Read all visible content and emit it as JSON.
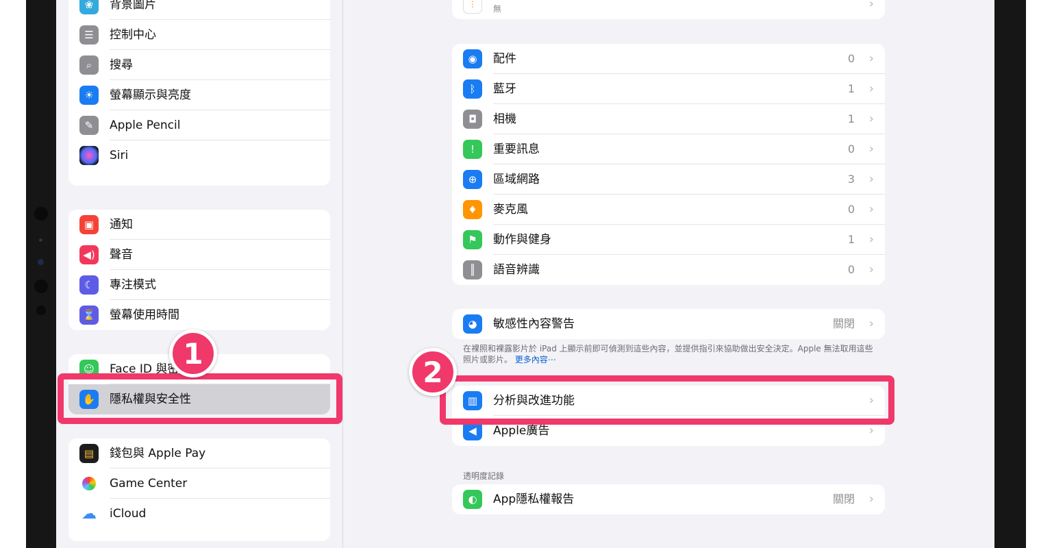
{
  "sidebar": {
    "group1": [
      {
        "icon": "wallpaper-icon",
        "label": "背景圖片",
        "color": "#34aadc"
      },
      {
        "icon": "control-center-icon",
        "label": "控制中心",
        "color": "#8e8e93"
      },
      {
        "icon": "search-icon",
        "label": "搜尋",
        "color": "#8e8e93"
      },
      {
        "icon": "brightness-icon",
        "label": "螢幕顯示與亮度",
        "color": "#1a7cf2"
      },
      {
        "icon": "pencil-icon",
        "label": "Apple Pencil",
        "color": "#8e8e93"
      },
      {
        "icon": "siri-icon",
        "label": "Siri",
        "color": "#333333"
      }
    ],
    "group2": [
      {
        "icon": "notification-icon",
        "label": "通知",
        "color": "#f44336"
      },
      {
        "icon": "sound-icon",
        "label": "聲音",
        "color": "#f2385a"
      },
      {
        "icon": "moon-icon",
        "label": "專注模式",
        "color": "#5e5ce6"
      },
      {
        "icon": "hourglass-icon",
        "label": "螢幕使用時間",
        "color": "#5e5ce6"
      }
    ],
    "group3": [
      {
        "icon": "faceid-icon",
        "label": "Face ID 與密碼",
        "color": "#34c759"
      },
      {
        "icon": "hand-icon",
        "label": "隱私權與安全性",
        "color": "#1a7cf2"
      }
    ],
    "group4": [
      {
        "icon": "wallet-icon",
        "label": "錢包與 Apple Pay",
        "color": "#1c1c1e"
      },
      {
        "icon": "game-center-icon",
        "label": "Game Center",
        "color": "#ffffff"
      },
      {
        "icon": "icloud-icon",
        "label": "iCloud",
        "color": "#ffffff"
      }
    ]
  },
  "detail": {
    "top_value": "無",
    "group1": [
      {
        "icon": "accessory-icon",
        "label": "配件",
        "value": "0",
        "color": "#1a7cf2"
      },
      {
        "icon": "bluetooth-icon",
        "label": "藍牙",
        "value": "1",
        "color": "#1a7cf2"
      },
      {
        "icon": "camera-icon",
        "label": "相機",
        "value": "1",
        "color": "#8e8e93"
      },
      {
        "icon": "critical-message-icon",
        "label": "重要訊息",
        "value": "0",
        "color": "#34c759"
      },
      {
        "icon": "globe-icon",
        "label": "區域網路",
        "value": "3",
        "color": "#1a7cf2"
      },
      {
        "icon": "microphone-icon",
        "label": "麥克風",
        "value": "0",
        "color": "#ff9500"
      },
      {
        "icon": "fitness-icon",
        "label": "動作與健身",
        "value": "1",
        "color": "#34c759"
      },
      {
        "icon": "speech-icon",
        "label": "語音辨識",
        "value": "0",
        "color": "#8e8e93"
      }
    ],
    "sensitive": {
      "icon": "eye-warning-icon",
      "label": "敏感性內容警告",
      "value": "關閉",
      "color": "#1a7cf2"
    },
    "footnote_text": "在裸照和裸露影片於 iPad 上顯示前即可偵測到這些內容，並提供指引來協助做出安全決定。Apple 無法取用這些照片或影片。",
    "footnote_more": "更多內容⋯",
    "group3": [
      {
        "icon": "analytics-icon",
        "label": "分析與改進功能",
        "value": "",
        "color": "#1a7cf2"
      },
      {
        "icon": "megaphone-icon",
        "label": "Apple廣告",
        "value": "",
        "color": "#1a7cf2"
      }
    ],
    "transparency_header": "透明度記錄",
    "app_privacy": {
      "icon": "shield-icon",
      "label": "App隱私權報告",
      "value": "關閉",
      "color": "#34c759"
    }
  },
  "badges": {
    "one": "1",
    "two": "2"
  }
}
